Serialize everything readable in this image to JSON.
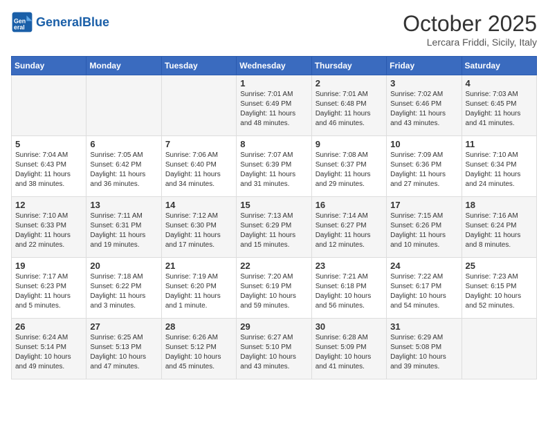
{
  "header": {
    "logo_text_general": "General",
    "logo_text_blue": "Blue",
    "month_title": "October 2025",
    "location": "Lercara Friddi, Sicily, Italy"
  },
  "days_of_week": [
    "Sunday",
    "Monday",
    "Tuesday",
    "Wednesday",
    "Thursday",
    "Friday",
    "Saturday"
  ],
  "weeks": [
    [
      {
        "day": "",
        "info": ""
      },
      {
        "day": "",
        "info": ""
      },
      {
        "day": "",
        "info": ""
      },
      {
        "day": "1",
        "info": "Sunrise: 7:01 AM\nSunset: 6:49 PM\nDaylight: 11 hours and 48 minutes."
      },
      {
        "day": "2",
        "info": "Sunrise: 7:01 AM\nSunset: 6:48 PM\nDaylight: 11 hours and 46 minutes."
      },
      {
        "day": "3",
        "info": "Sunrise: 7:02 AM\nSunset: 6:46 PM\nDaylight: 11 hours and 43 minutes."
      },
      {
        "day": "4",
        "info": "Sunrise: 7:03 AM\nSunset: 6:45 PM\nDaylight: 11 hours and 41 minutes."
      }
    ],
    [
      {
        "day": "5",
        "info": "Sunrise: 7:04 AM\nSunset: 6:43 PM\nDaylight: 11 hours and 38 minutes."
      },
      {
        "day": "6",
        "info": "Sunrise: 7:05 AM\nSunset: 6:42 PM\nDaylight: 11 hours and 36 minutes."
      },
      {
        "day": "7",
        "info": "Sunrise: 7:06 AM\nSunset: 6:40 PM\nDaylight: 11 hours and 34 minutes."
      },
      {
        "day": "8",
        "info": "Sunrise: 7:07 AM\nSunset: 6:39 PM\nDaylight: 11 hours and 31 minutes."
      },
      {
        "day": "9",
        "info": "Sunrise: 7:08 AM\nSunset: 6:37 PM\nDaylight: 11 hours and 29 minutes."
      },
      {
        "day": "10",
        "info": "Sunrise: 7:09 AM\nSunset: 6:36 PM\nDaylight: 11 hours and 27 minutes."
      },
      {
        "day": "11",
        "info": "Sunrise: 7:10 AM\nSunset: 6:34 PM\nDaylight: 11 hours and 24 minutes."
      }
    ],
    [
      {
        "day": "12",
        "info": "Sunrise: 7:10 AM\nSunset: 6:33 PM\nDaylight: 11 hours and 22 minutes."
      },
      {
        "day": "13",
        "info": "Sunrise: 7:11 AM\nSunset: 6:31 PM\nDaylight: 11 hours and 19 minutes."
      },
      {
        "day": "14",
        "info": "Sunrise: 7:12 AM\nSunset: 6:30 PM\nDaylight: 11 hours and 17 minutes."
      },
      {
        "day": "15",
        "info": "Sunrise: 7:13 AM\nSunset: 6:29 PM\nDaylight: 11 hours and 15 minutes."
      },
      {
        "day": "16",
        "info": "Sunrise: 7:14 AM\nSunset: 6:27 PM\nDaylight: 11 hours and 12 minutes."
      },
      {
        "day": "17",
        "info": "Sunrise: 7:15 AM\nSunset: 6:26 PM\nDaylight: 11 hours and 10 minutes."
      },
      {
        "day": "18",
        "info": "Sunrise: 7:16 AM\nSunset: 6:24 PM\nDaylight: 11 hours and 8 minutes."
      }
    ],
    [
      {
        "day": "19",
        "info": "Sunrise: 7:17 AM\nSunset: 6:23 PM\nDaylight: 11 hours and 5 minutes."
      },
      {
        "day": "20",
        "info": "Sunrise: 7:18 AM\nSunset: 6:22 PM\nDaylight: 11 hours and 3 minutes."
      },
      {
        "day": "21",
        "info": "Sunrise: 7:19 AM\nSunset: 6:20 PM\nDaylight: 11 hours and 1 minute."
      },
      {
        "day": "22",
        "info": "Sunrise: 7:20 AM\nSunset: 6:19 PM\nDaylight: 10 hours and 59 minutes."
      },
      {
        "day": "23",
        "info": "Sunrise: 7:21 AM\nSunset: 6:18 PM\nDaylight: 10 hours and 56 minutes."
      },
      {
        "day": "24",
        "info": "Sunrise: 7:22 AM\nSunset: 6:17 PM\nDaylight: 10 hours and 54 minutes."
      },
      {
        "day": "25",
        "info": "Sunrise: 7:23 AM\nSunset: 6:15 PM\nDaylight: 10 hours and 52 minutes."
      }
    ],
    [
      {
        "day": "26",
        "info": "Sunrise: 6:24 AM\nSunset: 5:14 PM\nDaylight: 10 hours and 49 minutes."
      },
      {
        "day": "27",
        "info": "Sunrise: 6:25 AM\nSunset: 5:13 PM\nDaylight: 10 hours and 47 minutes."
      },
      {
        "day": "28",
        "info": "Sunrise: 6:26 AM\nSunset: 5:12 PM\nDaylight: 10 hours and 45 minutes."
      },
      {
        "day": "29",
        "info": "Sunrise: 6:27 AM\nSunset: 5:10 PM\nDaylight: 10 hours and 43 minutes."
      },
      {
        "day": "30",
        "info": "Sunrise: 6:28 AM\nSunset: 5:09 PM\nDaylight: 10 hours and 41 minutes."
      },
      {
        "day": "31",
        "info": "Sunrise: 6:29 AM\nSunset: 5:08 PM\nDaylight: 10 hours and 39 minutes."
      },
      {
        "day": "",
        "info": ""
      }
    ]
  ]
}
